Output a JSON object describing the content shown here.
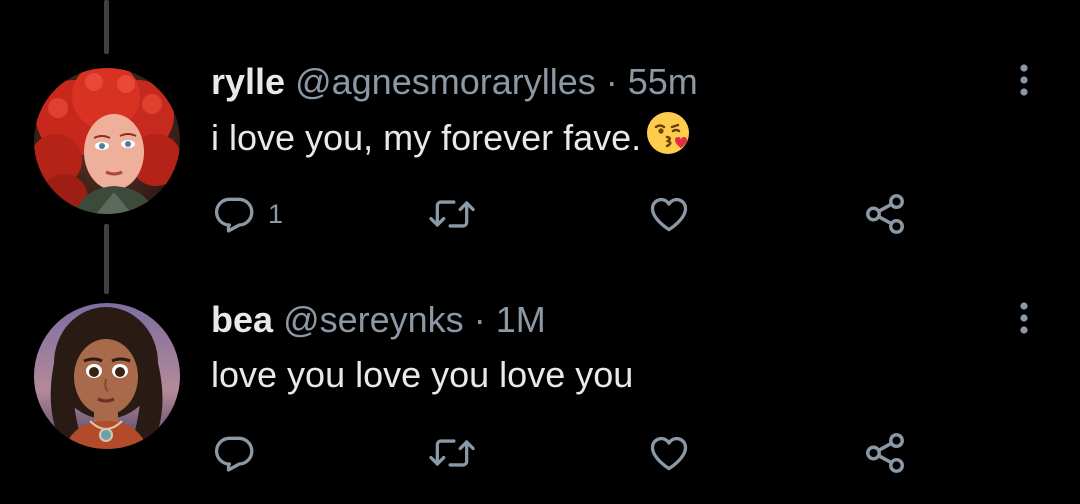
{
  "colors": {
    "background": "#000000",
    "primary_text": "#e7e9ea",
    "secondary_text": "#8b98a5",
    "thread_line": "#3d4145",
    "icon": "#8b98a5"
  },
  "tweets": [
    {
      "name": "rylle",
      "handle": "@agnesmorarylles",
      "separator": "·",
      "time": "55m",
      "text": "i love you, my forever fave.",
      "emoji": "face-blowing-kiss",
      "avatar": "red-curly-hair-avatar",
      "reply_count": "1",
      "retweet_count": "",
      "like_count": ""
    },
    {
      "name": "bea",
      "handle": "@sereynks",
      "separator": "·",
      "time": "1M",
      "text": "love you love you love you",
      "avatar": "dark-hair-island-avatar",
      "reply_count": "",
      "retweet_count": "",
      "like_count": ""
    }
  ],
  "icons": {
    "reply": "reply-icon",
    "retweet": "retweet-icon",
    "like": "heart-icon",
    "share": "share-icon",
    "more": "more-vertical-icon"
  }
}
